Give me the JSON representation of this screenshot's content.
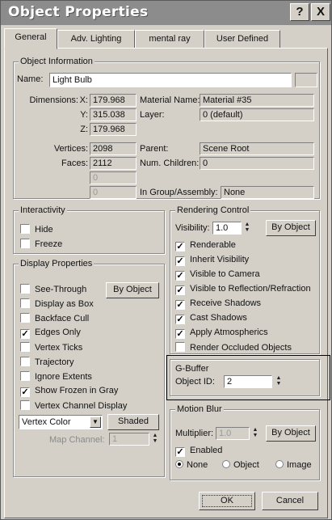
{
  "window": {
    "title": "Object Properties",
    "help_label": "?",
    "close_label": "X"
  },
  "tabs": [
    "General",
    "Adv. Lighting",
    "mental ray",
    "User Defined"
  ],
  "object_info": {
    "title": "Object Information",
    "name_label": "Name:",
    "name_value": "Light Bulb",
    "dimensions_label": "Dimensions:",
    "x_label": "X:",
    "x_value": "179.968",
    "y_label": "Y:",
    "y_value": "315.038",
    "z_label": "Z:",
    "z_value": "179.968",
    "material_label": "Material Name:",
    "material_value": "Material #35",
    "layer_label": "Layer:",
    "layer_value": "0 (default)",
    "vertices_label": "Vertices:",
    "vertices_value": "2098",
    "faces_label": "Faces:",
    "faces_value": "2112",
    "parent_label": "Parent:",
    "parent_value": "Scene Root",
    "children_label": "Num. Children:",
    "children_value": "0",
    "blank1_value": "0",
    "blank2_value": "0",
    "group_label": "In Group/Assembly:",
    "group_value": "None"
  },
  "interactivity": {
    "title": "Interactivity",
    "hide": "Hide",
    "freeze": "Freeze"
  },
  "display": {
    "title": "Display Properties",
    "by_object": "By Object",
    "items": [
      {
        "label": "See-Through",
        "checked": ""
      },
      {
        "label": "Display as Box",
        "checked": ""
      },
      {
        "label": "Backface Cull",
        "checked": ""
      },
      {
        "label": "Edges Only",
        "checked": "✓"
      },
      {
        "label": "Vertex Ticks",
        "checked": ""
      },
      {
        "label": "Trajectory",
        "checked": ""
      },
      {
        "label": "Ignore Extents",
        "checked": ""
      },
      {
        "label": "Show Frozen in Gray",
        "checked": "✓"
      },
      {
        "label": "Vertex Channel Display",
        "checked": ""
      }
    ],
    "vertex_color": "Vertex Color",
    "shaded": "Shaded",
    "map_channel_label": "Map Channel:",
    "map_channel_value": "1"
  },
  "rendering": {
    "title": "Rendering Control",
    "visibility_label": "Visibility:",
    "visibility_value": "1.0",
    "by_object": "By Object",
    "items": [
      {
        "label": "Renderable",
        "checked": "✓"
      },
      {
        "label": "Inherit Visibility",
        "checked": "✓"
      },
      {
        "label": "Visible to Camera",
        "checked": "✓"
      },
      {
        "label": "Visible to Reflection/Refraction",
        "checked": "✓"
      },
      {
        "label": "Receive Shadows",
        "checked": "✓"
      },
      {
        "label": "Cast Shadows",
        "checked": "✓"
      },
      {
        "label": "Apply Atmospherics",
        "checked": "✓"
      },
      {
        "label": "Render Occluded Objects",
        "checked": ""
      }
    ]
  },
  "gbuffer": {
    "title": "G-Buffer",
    "object_id_label": "Object ID:",
    "object_id_value": "2"
  },
  "motion_blur": {
    "title": "Motion Blur",
    "multiplier_label": "Multiplier:",
    "multiplier_value": "1.0",
    "by_object": "By Object",
    "enabled": "Enabled",
    "enabled_checked": "✓",
    "none": "None",
    "object": "Object",
    "image": "Image"
  },
  "footer": {
    "ok": "OK",
    "cancel": "Cancel"
  }
}
